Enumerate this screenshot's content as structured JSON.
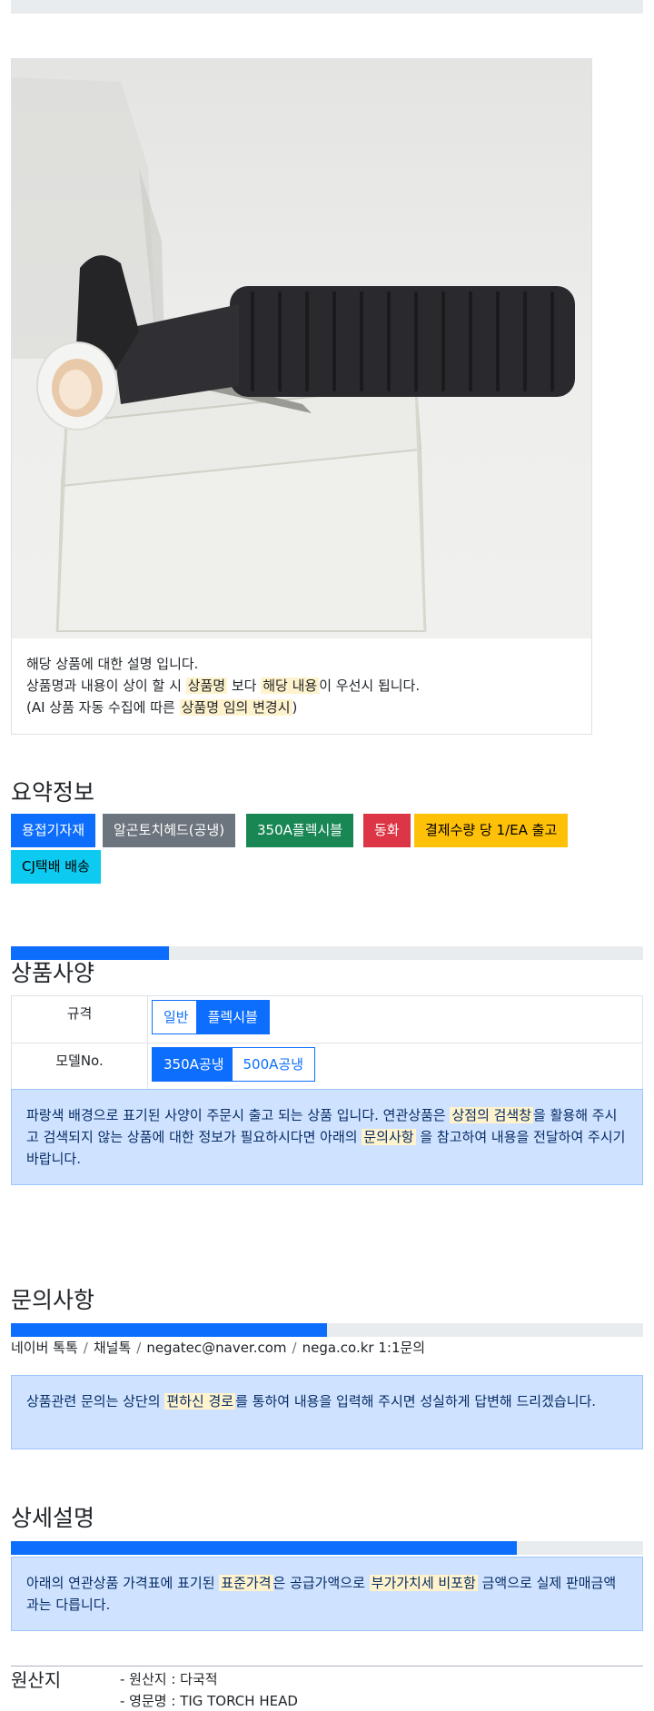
{
  "photo": {
    "desc_line1": "해당 상품에 대한 설명 입니다.",
    "desc_line2_pre": "상품명과 내용이 상이 할 시",
    "desc_line2_hl1": "상품명",
    "desc_line2_mid": "보다",
    "desc_line2_hl2": "해당 내용",
    "desc_line2_post": "이 우선시 됩니다.",
    "desc_line3_pre": "(AI 상품 자동 수집에 따른",
    "desc_line3_hl": "상품명 임의 변경시",
    "desc_line3_post": ")"
  },
  "summary": {
    "title": "요약정보",
    "tags": [
      {
        "label": "용접기자재",
        "color": "#0d6efd",
        "text_color": "#ffffff"
      },
      {
        "label": "알곤토치헤드(공냉)",
        "color": "#6c757d",
        "text_color": "#ffffff"
      },
      {
        "label": "350A플렉시블",
        "color": "#198754",
        "text_color": "#ffffff"
      },
      {
        "label": "동화",
        "color": "#dc3545",
        "text_color": "#ffffff"
      },
      {
        "label": "결제수량 당 1/EA 출고",
        "color": "#ffc107",
        "text_color": "#000000"
      },
      {
        "label": "CJ택배 배송",
        "color": "#0dcaf0",
        "text_color": "#000000"
      }
    ]
  },
  "spec": {
    "title": "상품사양",
    "progress": 0.25,
    "rows": [
      {
        "label": "규격",
        "options": [
          {
            "label": "일반",
            "active": false
          },
          {
            "label": "플렉시블",
            "active": true
          }
        ]
      },
      {
        "label": "모델No.",
        "options": [
          {
            "label": "350A공냉",
            "active": true
          },
          {
            "label": "500A공냉",
            "active": false
          }
        ]
      }
    ],
    "notice_pre": "파랑색 배경으로 표기된 사양이 주문시 출고 되는 상품 입니다. 연관상품은",
    "notice_hl1": "상점의 검색창",
    "notice_mid": "을 활용해 주시고 검색되지 않는 상품에 대한 정보가 필요하시다면 아래의",
    "notice_hl2": "문의사항",
    "notice_post": "을 참고하여 내용을 전달하여 주시기 바랍니다."
  },
  "inquiry": {
    "title": "문의사항",
    "progress": 0.5,
    "channels": [
      "네이버 톡톡",
      "채널톡",
      "negatec@naver.com",
      "nega.co.kr 1:1문의"
    ],
    "separator": "/",
    "notice_pre": "상품관련 문의는 상단의",
    "notice_hl": "편하신 경로",
    "notice_post": "를 통하여 내용을 입력해 주시면 성실하게 답변해 드리겠습니다."
  },
  "detail": {
    "title": "상세설명",
    "progress": 0.8,
    "notice_pre": "아래의 연관상품 가격표에 표기된",
    "notice_hl1": "표준가격",
    "notice_mid": "은 공급가액으로",
    "notice_hl2": "부가가치세 비포함",
    "notice_post": "금액으로 실제 판매금액과는 다릅니다."
  },
  "origin": {
    "title": "원산지",
    "items": [
      "- 원산지 : 다국적",
      "- 영문명 : TIG TORCH HEAD"
    ]
  }
}
